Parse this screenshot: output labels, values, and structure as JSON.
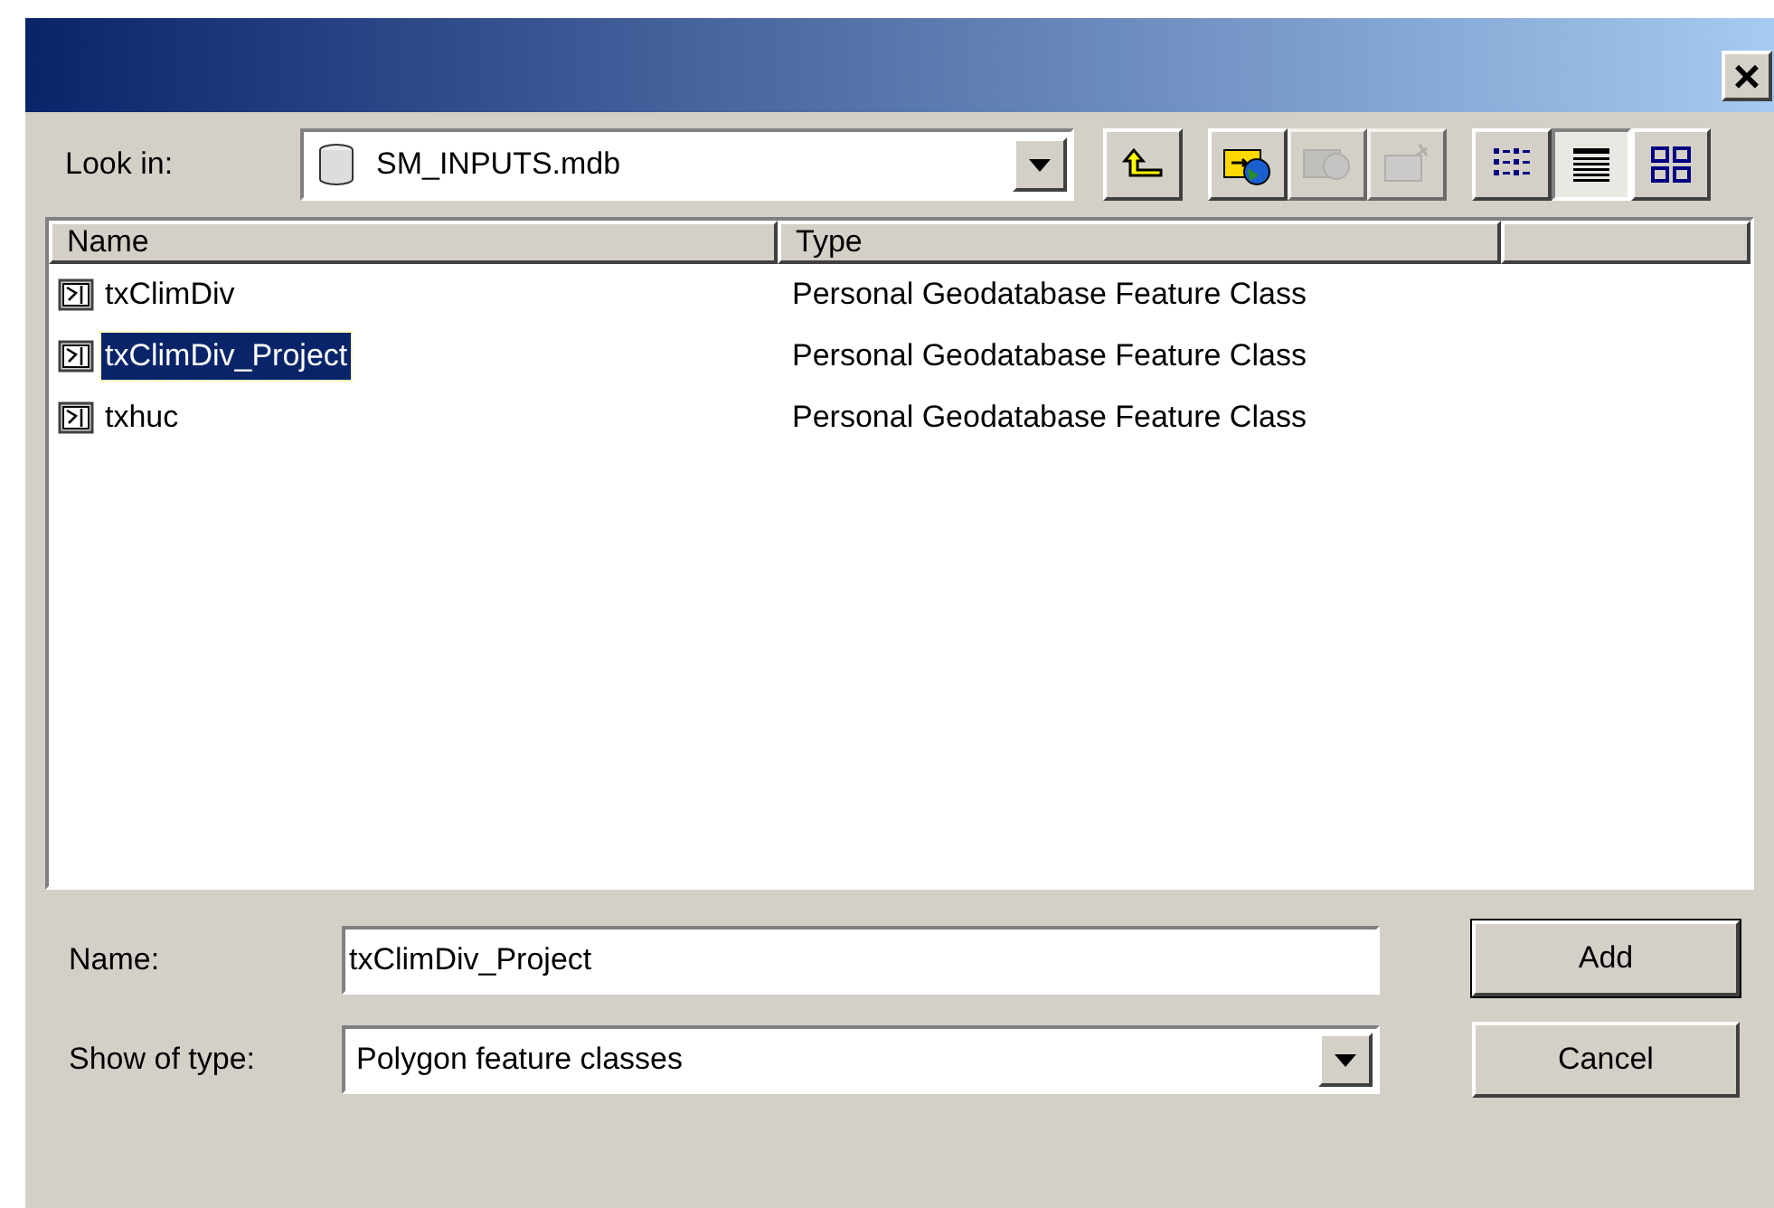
{
  "dialog": {
    "close": "×"
  },
  "look_in": {
    "label": "Look in:",
    "value": "SM_INPUTS.mdb"
  },
  "toolbar": [
    {
      "kind": "up",
      "disabled": false
    },
    {
      "kind": "connect",
      "disabled": false
    },
    {
      "kind": "disconnect",
      "disabled": true
    },
    {
      "kind": "newfolder",
      "disabled": true
    }
  ],
  "views": [
    {
      "kind": "list",
      "selected": false
    },
    {
      "kind": "details",
      "selected": true
    },
    {
      "kind": "thumbnails",
      "selected": false
    }
  ],
  "table": {
    "columns": [
      "Name",
      "Type"
    ],
    "rows": [
      {
        "name": "txClimDiv",
        "type": "Personal Geodatabase Feature Class",
        "selected": false
      },
      {
        "name": "txClimDiv_Project",
        "type": "Personal Geodatabase Feature Class",
        "selected": true
      },
      {
        "name": "txhuc",
        "type": "Personal Geodatabase Feature Class",
        "selected": false
      }
    ]
  },
  "name_field": {
    "label": "Name:",
    "value": "txClimDiv_Project"
  },
  "type_field": {
    "label": "Show of type:",
    "value": "Polygon feature classes"
  },
  "buttons": [
    "Add",
    "Cancel"
  ]
}
